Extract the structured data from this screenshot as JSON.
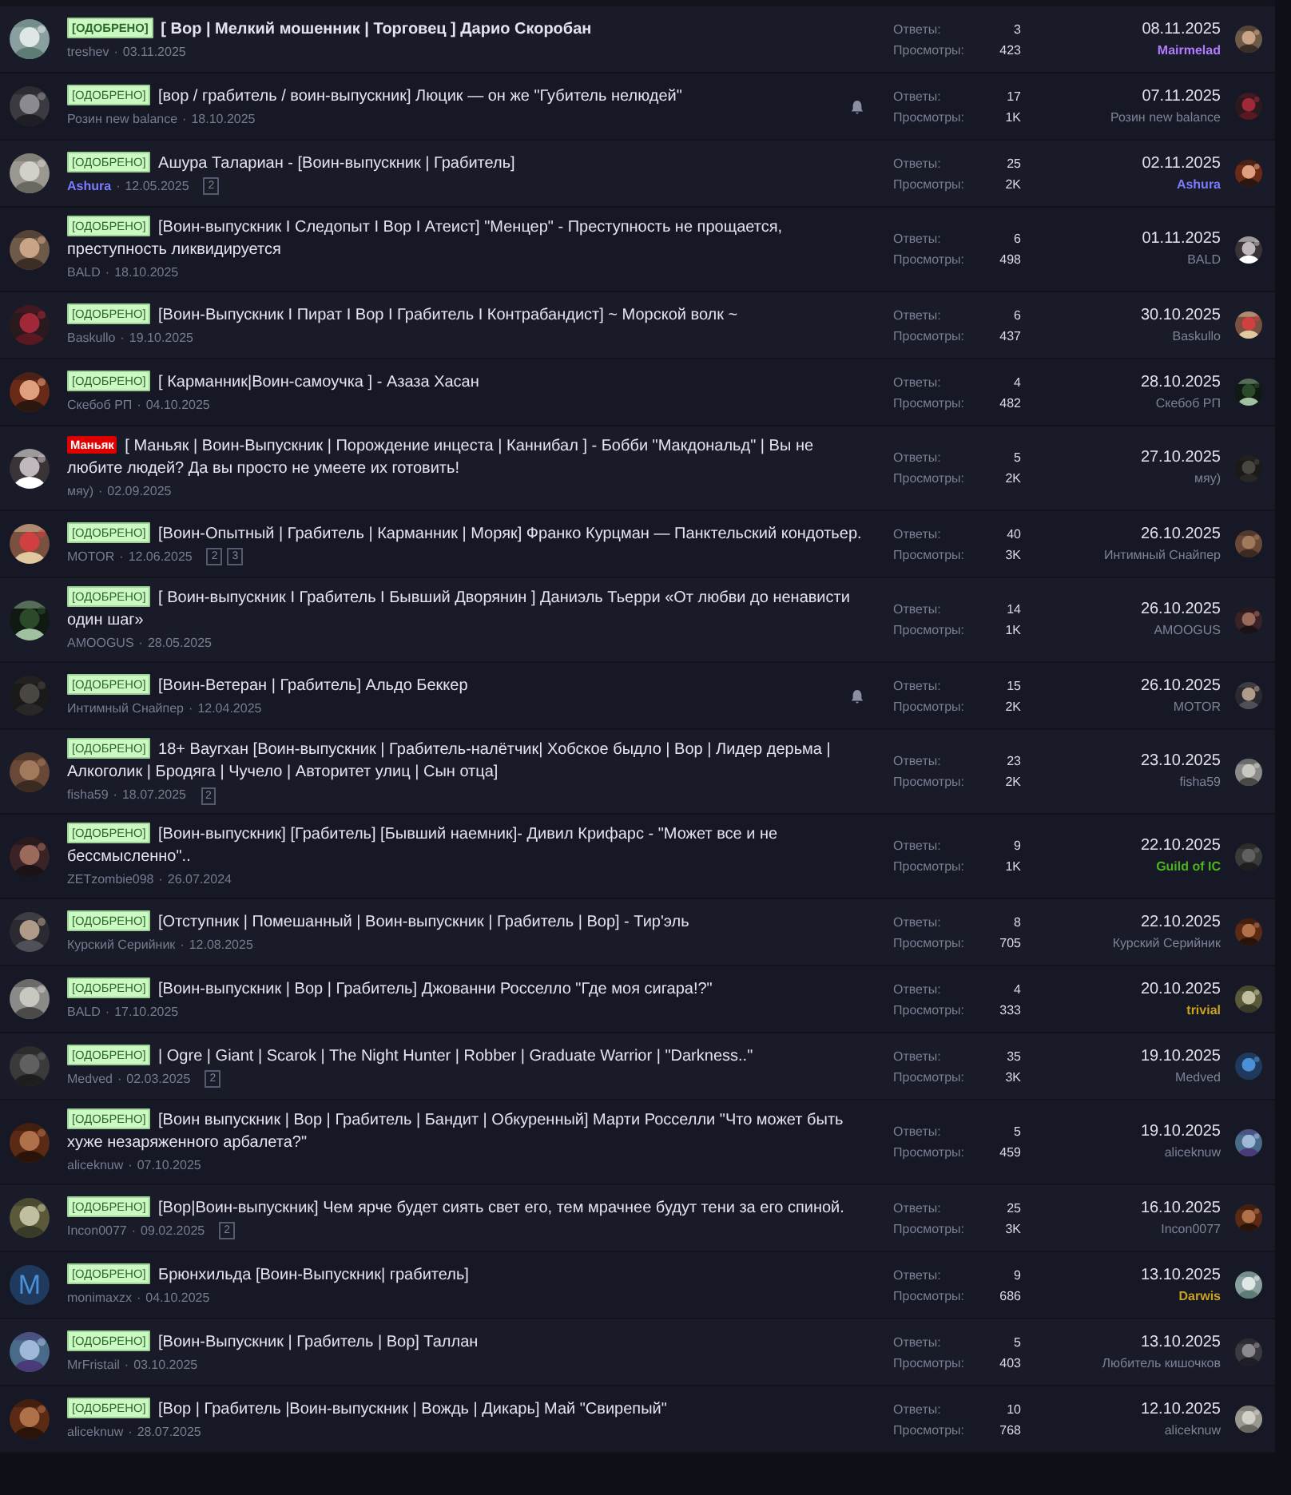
{
  "threads": [
    {
      "prefix": {
        "kind": "approved",
        "text": "[ОДОБРЕНО]"
      },
      "title": "[ Вор | Мелкий мошенник | Торговец ] Дарио Скоробан",
      "unread": true,
      "author": {
        "name": "treshev"
      },
      "separator": "·",
      "date": "03.11.2025",
      "watched": false,
      "replies_label": "Ответы:",
      "replies": "3",
      "views_label": "Просмотры:",
      "views": "423",
      "last_date": "08.11.2025",
      "last_poster": {
        "name": "Mairmelad",
        "color": "#b27cff"
      }
    },
    {
      "prefix": {
        "kind": "approved",
        "text": "[ОДОБРЕНО]"
      },
      "title": "[вор / грабитель / воин-выпускник] Люцик — он же \"Губитель нелюдей\"",
      "unread": false,
      "author": {
        "name": "Розин new balance"
      },
      "separator": "·",
      "date": "18.10.2025",
      "watched": true,
      "replies_label": "Ответы:",
      "replies": "17",
      "views_label": "Просмотры:",
      "views": "1K",
      "last_date": "07.11.2025",
      "last_poster": {
        "name": "Розин new balance"
      }
    },
    {
      "prefix": {
        "kind": "approved",
        "text": "[ОДОБРЕНО]"
      },
      "title": "Ашура Талариан - [Воин-выпускник | Грабитель]",
      "unread": false,
      "author": {
        "name": "Ashura",
        "color": "#7c7cff"
      },
      "separator": "·",
      "date": "12.05.2025",
      "pages": [
        "2"
      ],
      "watched": false,
      "replies_label": "Ответы:",
      "replies": "25",
      "views_label": "Просмотры:",
      "views": "2K",
      "last_date": "02.11.2025",
      "last_poster": {
        "name": "Ashura",
        "color": "#7c7cff"
      }
    },
    {
      "prefix": {
        "kind": "approved",
        "text": "[ОДОБРЕНО]"
      },
      "title": "[Воин-выпускник I Следопыт I Вор I Атеист] \"Менцер\" - Преступность не прощается, преступность ликвидируется",
      "unread": false,
      "author": {
        "name": "BALD"
      },
      "separator": "·",
      "date": "18.10.2025",
      "watched": false,
      "replies_label": "Ответы:",
      "replies": "6",
      "views_label": "Просмотры:",
      "views": "498",
      "last_date": "01.11.2025",
      "last_poster": {
        "name": "BALD"
      }
    },
    {
      "prefix": {
        "kind": "approved",
        "text": "[ОДОБРЕНО]"
      },
      "title": "[Воин-Выпускник I Пират I Вор I Грабитель I Контрабандист] ~ Морской волк ~",
      "unread": false,
      "author": {
        "name": "Baskullo"
      },
      "separator": "·",
      "date": "19.10.2025",
      "watched": false,
      "replies_label": "Ответы:",
      "replies": "6",
      "views_label": "Просмотры:",
      "views": "437",
      "last_date": "30.10.2025",
      "last_poster": {
        "name": "Baskullo"
      }
    },
    {
      "prefix": {
        "kind": "approved",
        "text": "[ОДОБРЕНО]"
      },
      "title": "[ Карманник|Воин-самоучка ] - Азаза Хасан",
      "unread": false,
      "author": {
        "name": "Скебоб РП"
      },
      "separator": "·",
      "date": "04.10.2025",
      "watched": false,
      "replies_label": "Ответы:",
      "replies": "4",
      "views_label": "Просмотры:",
      "views": "482",
      "last_date": "28.10.2025",
      "last_poster": {
        "name": "Скебоб РП"
      }
    },
    {
      "prefix": {
        "kind": "maniac",
        "text": "Маньяк"
      },
      "title": "[ Маньяк | Воин-Выпускник | Порождение инцеста | Каннибал ] - Бобби \"Макдональд\" | Вы не любите людей? Да вы просто не умеете их готовить!",
      "unread": false,
      "author": {
        "name": "мяу)"
      },
      "separator": "·",
      "date": "02.09.2025",
      "watched": false,
      "replies_label": "Ответы:",
      "replies": "5",
      "views_label": "Просмотры:",
      "views": "2K",
      "last_date": "27.10.2025",
      "last_poster": {
        "name": "мяу)"
      }
    },
    {
      "prefix": {
        "kind": "approved",
        "text": "[ОДОБРЕНО]"
      },
      "title": "[Воин-Опытный | Грабитель | Карманник | Моряк] Франко Курцман — Панктельский кондотьер.",
      "unread": false,
      "author": {
        "name": "MOTOR"
      },
      "separator": "·",
      "date": "12.06.2025",
      "pages": [
        "2",
        "3"
      ],
      "watched": false,
      "replies_label": "Ответы:",
      "replies": "40",
      "views_label": "Просмотры:",
      "views": "3K",
      "last_date": "26.10.2025",
      "last_poster": {
        "name": "Интимный Снайпер"
      }
    },
    {
      "prefix": {
        "kind": "approved",
        "text": "[ОДОБРЕНО]"
      },
      "title": "[ Воин-выпускник I Грабитель I Бывший Дворянин ] Даниэль Тьерри «От любви до ненависти один шаг»",
      "unread": false,
      "author": {
        "name": "AMOOGUS"
      },
      "separator": "·",
      "date": "28.05.2025",
      "watched": false,
      "replies_label": "Ответы:",
      "replies": "14",
      "views_label": "Просмотры:",
      "views": "1K",
      "last_date": "26.10.2025",
      "last_poster": {
        "name": "AMOOGUS"
      }
    },
    {
      "prefix": {
        "kind": "approved",
        "text": "[ОДОБРЕНО]"
      },
      "title": "[Воин-Ветеран | Грабитель] Альдо Беккер",
      "unread": false,
      "author": {
        "name": "Интимный Снайпер"
      },
      "separator": "·",
      "date": "12.04.2025",
      "watched": true,
      "replies_label": "Ответы:",
      "replies": "15",
      "views_label": "Просмотры:",
      "views": "2K",
      "last_date": "26.10.2025",
      "last_poster": {
        "name": "MOTOR"
      }
    },
    {
      "prefix": {
        "kind": "approved",
        "text": "[ОДОБРЕНО]"
      },
      "title": "18+ Ваугхан [Воин-выпускник | Грабитель-налётчик| Хобское быдло | Вор | Лидер дерьма | Алкоголик | Бродяга | Чучело | Авторитет улиц | Сын отца]",
      "unread": false,
      "author": {
        "name": "fisha59"
      },
      "separator": "·",
      "date": "18.07.2025",
      "pages": [
        "2"
      ],
      "watched": false,
      "replies_label": "Ответы:",
      "replies": "23",
      "views_label": "Просмотры:",
      "views": "2K",
      "last_date": "23.10.2025",
      "last_poster": {
        "name": "fisha59"
      }
    },
    {
      "prefix": {
        "kind": "approved",
        "text": "[ОДОБРЕНО]"
      },
      "title": "[Воин-выпускник] [Грабитель] [Бывший наемник]- Дивил Крифарс - \"Может все и не бессмысленно\"..",
      "unread": false,
      "author": {
        "name": "ZETzombie098"
      },
      "separator": "·",
      "date": "26.07.2024",
      "watched": false,
      "replies_label": "Ответы:",
      "replies": "9",
      "views_label": "Просмотры:",
      "views": "1K",
      "last_date": "22.10.2025",
      "last_poster": {
        "name": "Guild of IC",
        "color": "#4cb31c"
      }
    },
    {
      "prefix": {
        "kind": "approved",
        "text": "[ОДОБРЕНО]"
      },
      "title": "[Отступник | Помешанный | Воин-выпускник | Грабитель | Вор] - Тир'эль",
      "unread": false,
      "author": {
        "name": "Курский Серийник"
      },
      "separator": "·",
      "date": "12.08.2025",
      "watched": false,
      "replies_label": "Ответы:",
      "replies": "8",
      "views_label": "Просмотры:",
      "views": "705",
      "last_date": "22.10.2025",
      "last_poster": {
        "name": "Курский Серийник"
      }
    },
    {
      "prefix": {
        "kind": "approved",
        "text": "[ОДОБРЕНО]"
      },
      "title": "[Воин-выпускник | Вор | Грабитель] Джованни Росселло \"Где моя сигара!?\"",
      "unread": false,
      "author": {
        "name": "BALD"
      },
      "separator": "·",
      "date": "17.10.2025",
      "watched": false,
      "replies_label": "Ответы:",
      "replies": "4",
      "views_label": "Просмотры:",
      "views": "333",
      "last_date": "20.10.2025",
      "last_poster": {
        "name": "trivial",
        "color": "#c9a21f"
      }
    },
    {
      "prefix": {
        "kind": "approved",
        "text": "[ОДОБРЕНО]"
      },
      "title": "| Ogre | Giant | Scarok | The Night Hunter | Robber | Graduate Warrior | \"Darkness..\"",
      "unread": false,
      "author": {
        "name": "Medved"
      },
      "separator": "·",
      "date": "02.03.2025",
      "pages": [
        "2"
      ],
      "watched": false,
      "replies_label": "Ответы:",
      "replies": "35",
      "views_label": "Просмотры:",
      "views": "3K",
      "last_date": "19.10.2025",
      "last_poster": {
        "name": "Medved"
      }
    },
    {
      "prefix": {
        "kind": "approved",
        "text": "[ОДОБРЕНО]"
      },
      "title": "[Воин выпускник | Вор | Грабитель | Бандит | Обкуренный] Марти Росселли \"Что может быть хуже незаряженного арбалета?\"",
      "unread": false,
      "author": {
        "name": "aliceknuw"
      },
      "separator": "·",
      "date": "07.10.2025",
      "watched": false,
      "replies_label": "Ответы:",
      "replies": "5",
      "views_label": "Просмотры:",
      "views": "459",
      "last_date": "19.10.2025",
      "last_poster": {
        "name": "aliceknuw"
      }
    },
    {
      "prefix": {
        "kind": "approved",
        "text": "[ОДОБРЕНО]"
      },
      "title": "[Вор|Воин-выпускник] Чем ярче будет сиять свет его, тем мрачнее будут тени за его спиной.",
      "unread": false,
      "author": {
        "name": "Incon0077"
      },
      "separator": "·",
      "date": "09.02.2025",
      "pages": [
        "2"
      ],
      "watched": false,
      "replies_label": "Ответы:",
      "replies": "25",
      "views_label": "Просмотры:",
      "views": "3K",
      "last_date": "16.10.2025",
      "last_poster": {
        "name": "Incon0077"
      }
    },
    {
      "prefix": {
        "kind": "approved",
        "text": "[ОДОБРЕНО]"
      },
      "title": "Брюнхильда [Воин-Выпускник| грабитель]",
      "unread": false,
      "author": {
        "name": "monimaxzx"
      },
      "avatar_letter": "M",
      "separator": "·",
      "date": "04.10.2025",
      "watched": false,
      "replies_label": "Ответы:",
      "replies": "9",
      "views_label": "Просмотры:",
      "views": "686",
      "last_date": "13.10.2025",
      "last_poster": {
        "name": "Darwis",
        "color": "#c9a21f"
      }
    },
    {
      "prefix": {
        "kind": "approved",
        "text": "[ОДОБРЕНО]"
      },
      "title": "[Воин-Выпускник | Грабитель | Вор] Таллан",
      "unread": false,
      "author": {
        "name": "MrFristail"
      },
      "separator": "·",
      "date": "03.10.2025",
      "watched": false,
      "replies_label": "Ответы:",
      "replies": "5",
      "views_label": "Просмотры:",
      "views": "403",
      "last_date": "13.10.2025",
      "last_poster": {
        "name": "Любитель кишочков"
      }
    },
    {
      "prefix": {
        "kind": "approved",
        "text": "[ОДОБРЕНО]"
      },
      "title": "[Вор | Грабитель |Воин-выпускник | Вождь | Дикарь] Май \"Свирепый\"",
      "unread": false,
      "author": {
        "name": "aliceknuw"
      },
      "separator": "·",
      "date": "28.07.2025",
      "watched": false,
      "replies_label": "Ответы:",
      "replies": "10",
      "views_label": "Просмотры:",
      "views": "768",
      "last_date": "12.10.2025",
      "last_poster": {
        "name": "aliceknuw"
      }
    }
  ]
}
